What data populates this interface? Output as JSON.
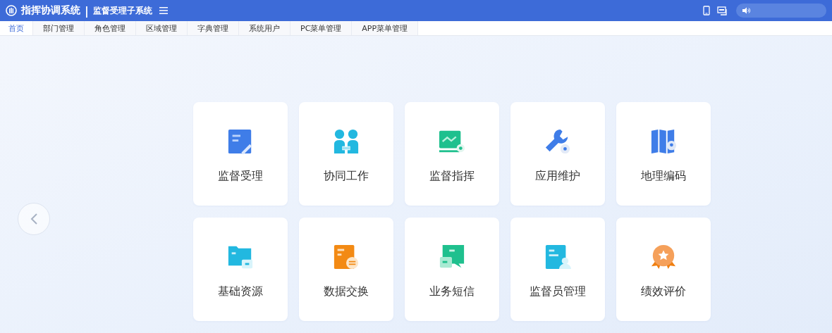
{
  "header": {
    "title": "指挥协调系统",
    "separator": "|",
    "subtitle": "监督受理子系统"
  },
  "tabs": [
    {
      "label": "首页",
      "selected": true
    },
    {
      "label": "部门管理",
      "selected": false
    },
    {
      "label": "角色管理",
      "selected": false
    },
    {
      "label": "区域管理",
      "selected": false
    },
    {
      "label": "字典管理",
      "selected": false
    },
    {
      "label": "系统用户",
      "selected": false
    },
    {
      "label": "PC菜单管理",
      "selected": false
    },
    {
      "label": "APP菜单管理",
      "selected": false
    }
  ],
  "modules": [
    {
      "label": "监督受理"
    },
    {
      "label": "协同工作"
    },
    {
      "label": "监督指挥"
    },
    {
      "label": "应用维护"
    },
    {
      "label": "地理编码"
    },
    {
      "label": "基础资源"
    },
    {
      "label": "数据交换"
    },
    {
      "label": "业务短信"
    },
    {
      "label": "监督员管理"
    },
    {
      "label": "绩效评价"
    }
  ]
}
